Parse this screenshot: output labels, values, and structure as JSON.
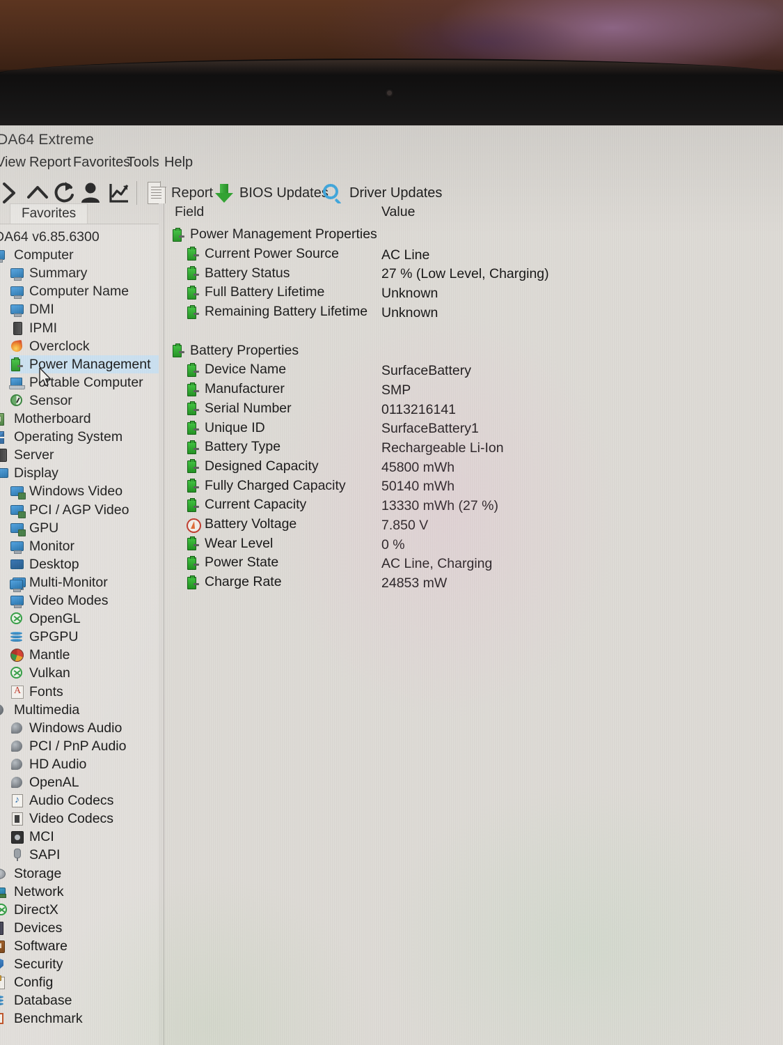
{
  "window": {
    "title": "DA64 Extreme",
    "menu": [
      "View",
      "Report",
      "Favorites",
      "Tools",
      "Help"
    ]
  },
  "toolbar": {
    "icons": [
      "forward-chevron-icon",
      "up-chevron-icon",
      "refresh-icon",
      "user-icon",
      "graph-icon"
    ],
    "buttons": [
      {
        "label": "Report",
        "icon": "document-icon"
      },
      {
        "label": "BIOS Updates",
        "icon": "green-down-arrow-icon"
      },
      {
        "label": "Driver Updates",
        "icon": "magnifier-icon"
      }
    ]
  },
  "sidebar": {
    "tab": "Favorites",
    "items": [
      {
        "label": "DA64 v6.85.6300",
        "level": 0,
        "icon": "none",
        "selected": false
      },
      {
        "label": "Computer",
        "level": 0,
        "icon": "computer-icon",
        "selected": false
      },
      {
        "label": "Summary",
        "level": 1,
        "icon": "monitor-icon",
        "selected": false
      },
      {
        "label": "Computer Name",
        "level": 1,
        "icon": "monitor-icon",
        "selected": false
      },
      {
        "label": "DMI",
        "level": 1,
        "icon": "monitor-icon",
        "selected": false
      },
      {
        "label": "IPMI",
        "level": 1,
        "icon": "server-tower-icon",
        "selected": false
      },
      {
        "label": "Overclock",
        "level": 1,
        "icon": "flame-icon",
        "selected": false
      },
      {
        "label": "Power Management",
        "level": 1,
        "icon": "battery-icon",
        "selected": true
      },
      {
        "label": "Portable Computer",
        "level": 1,
        "icon": "laptop-icon",
        "selected": false
      },
      {
        "label": "Sensor",
        "level": 1,
        "icon": "gauge-icon",
        "selected": false
      },
      {
        "label": "Motherboard",
        "level": 0,
        "icon": "motherboard-icon",
        "selected": false
      },
      {
        "label": "Operating System",
        "level": 0,
        "icon": "windows-icon",
        "selected": false
      },
      {
        "label": "Server",
        "level": 0,
        "icon": "server-tower-icon",
        "selected": false
      },
      {
        "label": "Display",
        "level": 0,
        "icon": "display-icon",
        "selected": false
      },
      {
        "label": "Windows Video",
        "level": 1,
        "icon": "video-card-icon",
        "selected": false
      },
      {
        "label": "PCI / AGP Video",
        "level": 1,
        "icon": "video-card-icon",
        "selected": false
      },
      {
        "label": "GPU",
        "level": 1,
        "icon": "video-card-icon",
        "selected": false
      },
      {
        "label": "Monitor",
        "level": 1,
        "icon": "monitor-icon",
        "selected": false
      },
      {
        "label": "Desktop",
        "level": 1,
        "icon": "desktop-icon",
        "selected": false
      },
      {
        "label": "Multi-Monitor",
        "level": 1,
        "icon": "multi-monitor-icon",
        "selected": false
      },
      {
        "label": "Video Modes",
        "level": 1,
        "icon": "monitor-icon",
        "selected": false
      },
      {
        "label": "OpenGL",
        "level": 1,
        "icon": "opengl-icon",
        "selected": false
      },
      {
        "label": "GPGPU",
        "level": 1,
        "icon": "stack-icon",
        "selected": false
      },
      {
        "label": "Mantle",
        "level": 1,
        "icon": "mantle-icon",
        "selected": false
      },
      {
        "label": "Vulkan",
        "level": 1,
        "icon": "vulkan-icon",
        "selected": false
      },
      {
        "label": "Fonts",
        "level": 1,
        "icon": "fonts-icon",
        "selected": false
      },
      {
        "label": "Multimedia",
        "level": 0,
        "icon": "multimedia-icon",
        "selected": false
      },
      {
        "label": "Windows Audio",
        "level": 1,
        "icon": "audio-icon",
        "selected": false
      },
      {
        "label": "PCI / PnP Audio",
        "level": 1,
        "icon": "audio-icon",
        "selected": false
      },
      {
        "label": "HD Audio",
        "level": 1,
        "icon": "audio-icon",
        "selected": false
      },
      {
        "label": "OpenAL",
        "level": 1,
        "icon": "audio-icon",
        "selected": false
      },
      {
        "label": "Audio Codecs",
        "level": 1,
        "icon": "music-note-icon",
        "selected": false
      },
      {
        "label": "Video Codecs",
        "level": 1,
        "icon": "video-codec-icon",
        "selected": false
      },
      {
        "label": "MCI",
        "level": 1,
        "icon": "mci-icon",
        "selected": false
      },
      {
        "label": "SAPI",
        "level": 1,
        "icon": "microphone-icon",
        "selected": false
      },
      {
        "label": "Storage",
        "level": 0,
        "icon": "storage-icon",
        "selected": false
      },
      {
        "label": "Network",
        "level": 0,
        "icon": "network-icon",
        "selected": false
      },
      {
        "label": "DirectX",
        "level": 0,
        "icon": "directx-icon",
        "selected": false
      },
      {
        "label": "Devices",
        "level": 0,
        "icon": "devices-icon",
        "selected": false
      },
      {
        "label": "Software",
        "level": 0,
        "icon": "software-icon",
        "selected": false
      },
      {
        "label": "Security",
        "level": 0,
        "icon": "shield-icon",
        "selected": false
      },
      {
        "label": "Config",
        "level": 0,
        "icon": "config-icon",
        "selected": false
      },
      {
        "label": "Database",
        "level": 0,
        "icon": "database-icon",
        "selected": false
      },
      {
        "label": "Benchmark",
        "level": 0,
        "icon": "benchmark-icon",
        "selected": false
      }
    ]
  },
  "content": {
    "columns": {
      "field": "Field",
      "value": "Value"
    },
    "groups": [
      {
        "title": "Power Management Properties",
        "icon": "battery-icon",
        "rows": [
          {
            "field": "Current Power Source",
            "value": "AC Line",
            "icon": "battery-icon"
          },
          {
            "field": "Battery Status",
            "value": "27 % (Low Level, Charging)",
            "icon": "battery-icon"
          },
          {
            "field": "Full Battery Lifetime",
            "value": "Unknown",
            "icon": "battery-icon"
          },
          {
            "field": "Remaining Battery Lifetime",
            "value": "Unknown",
            "icon": "battery-icon"
          }
        ]
      },
      {
        "title": "Battery Properties",
        "icon": "battery-icon",
        "rows": [
          {
            "field": "Device Name",
            "value": "SurfaceBattery",
            "icon": "battery-icon"
          },
          {
            "field": "Manufacturer",
            "value": "SMP",
            "icon": "battery-icon"
          },
          {
            "field": "Serial Number",
            "value": "0113216141",
            "icon": "battery-icon"
          },
          {
            "field": "Unique ID",
            "value": "SurfaceBattery1",
            "icon": "battery-icon"
          },
          {
            "field": "Battery Type",
            "value": "Rechargeable Li-Ion",
            "icon": "battery-icon"
          },
          {
            "field": "Designed Capacity",
            "value": "45800 mWh",
            "icon": "battery-icon"
          },
          {
            "field": "Fully Charged Capacity",
            "value": "50140 mWh",
            "icon": "battery-icon"
          },
          {
            "field": "Current Capacity",
            "value": "13330 mWh  (27 %)",
            "icon": "battery-icon"
          },
          {
            "field": "Battery Voltage",
            "value": "7.850 V",
            "icon": "voltage-icon"
          },
          {
            "field": "Wear Level",
            "value": "0 %",
            "icon": "battery-icon"
          },
          {
            "field": "Power State",
            "value": "AC Line, Charging",
            "icon": "battery-icon"
          },
          {
            "field": "Charge Rate",
            "value": "24853 mW",
            "icon": "battery-icon"
          }
        ]
      }
    ]
  },
  "colors": {
    "selection": "#c9e3f3",
    "battery_green": "#2ea62e",
    "app_bg": "#dedbd6",
    "sidebar_bg": "#e3e0dc",
    "accent_blue": "#3fa9e0"
  }
}
